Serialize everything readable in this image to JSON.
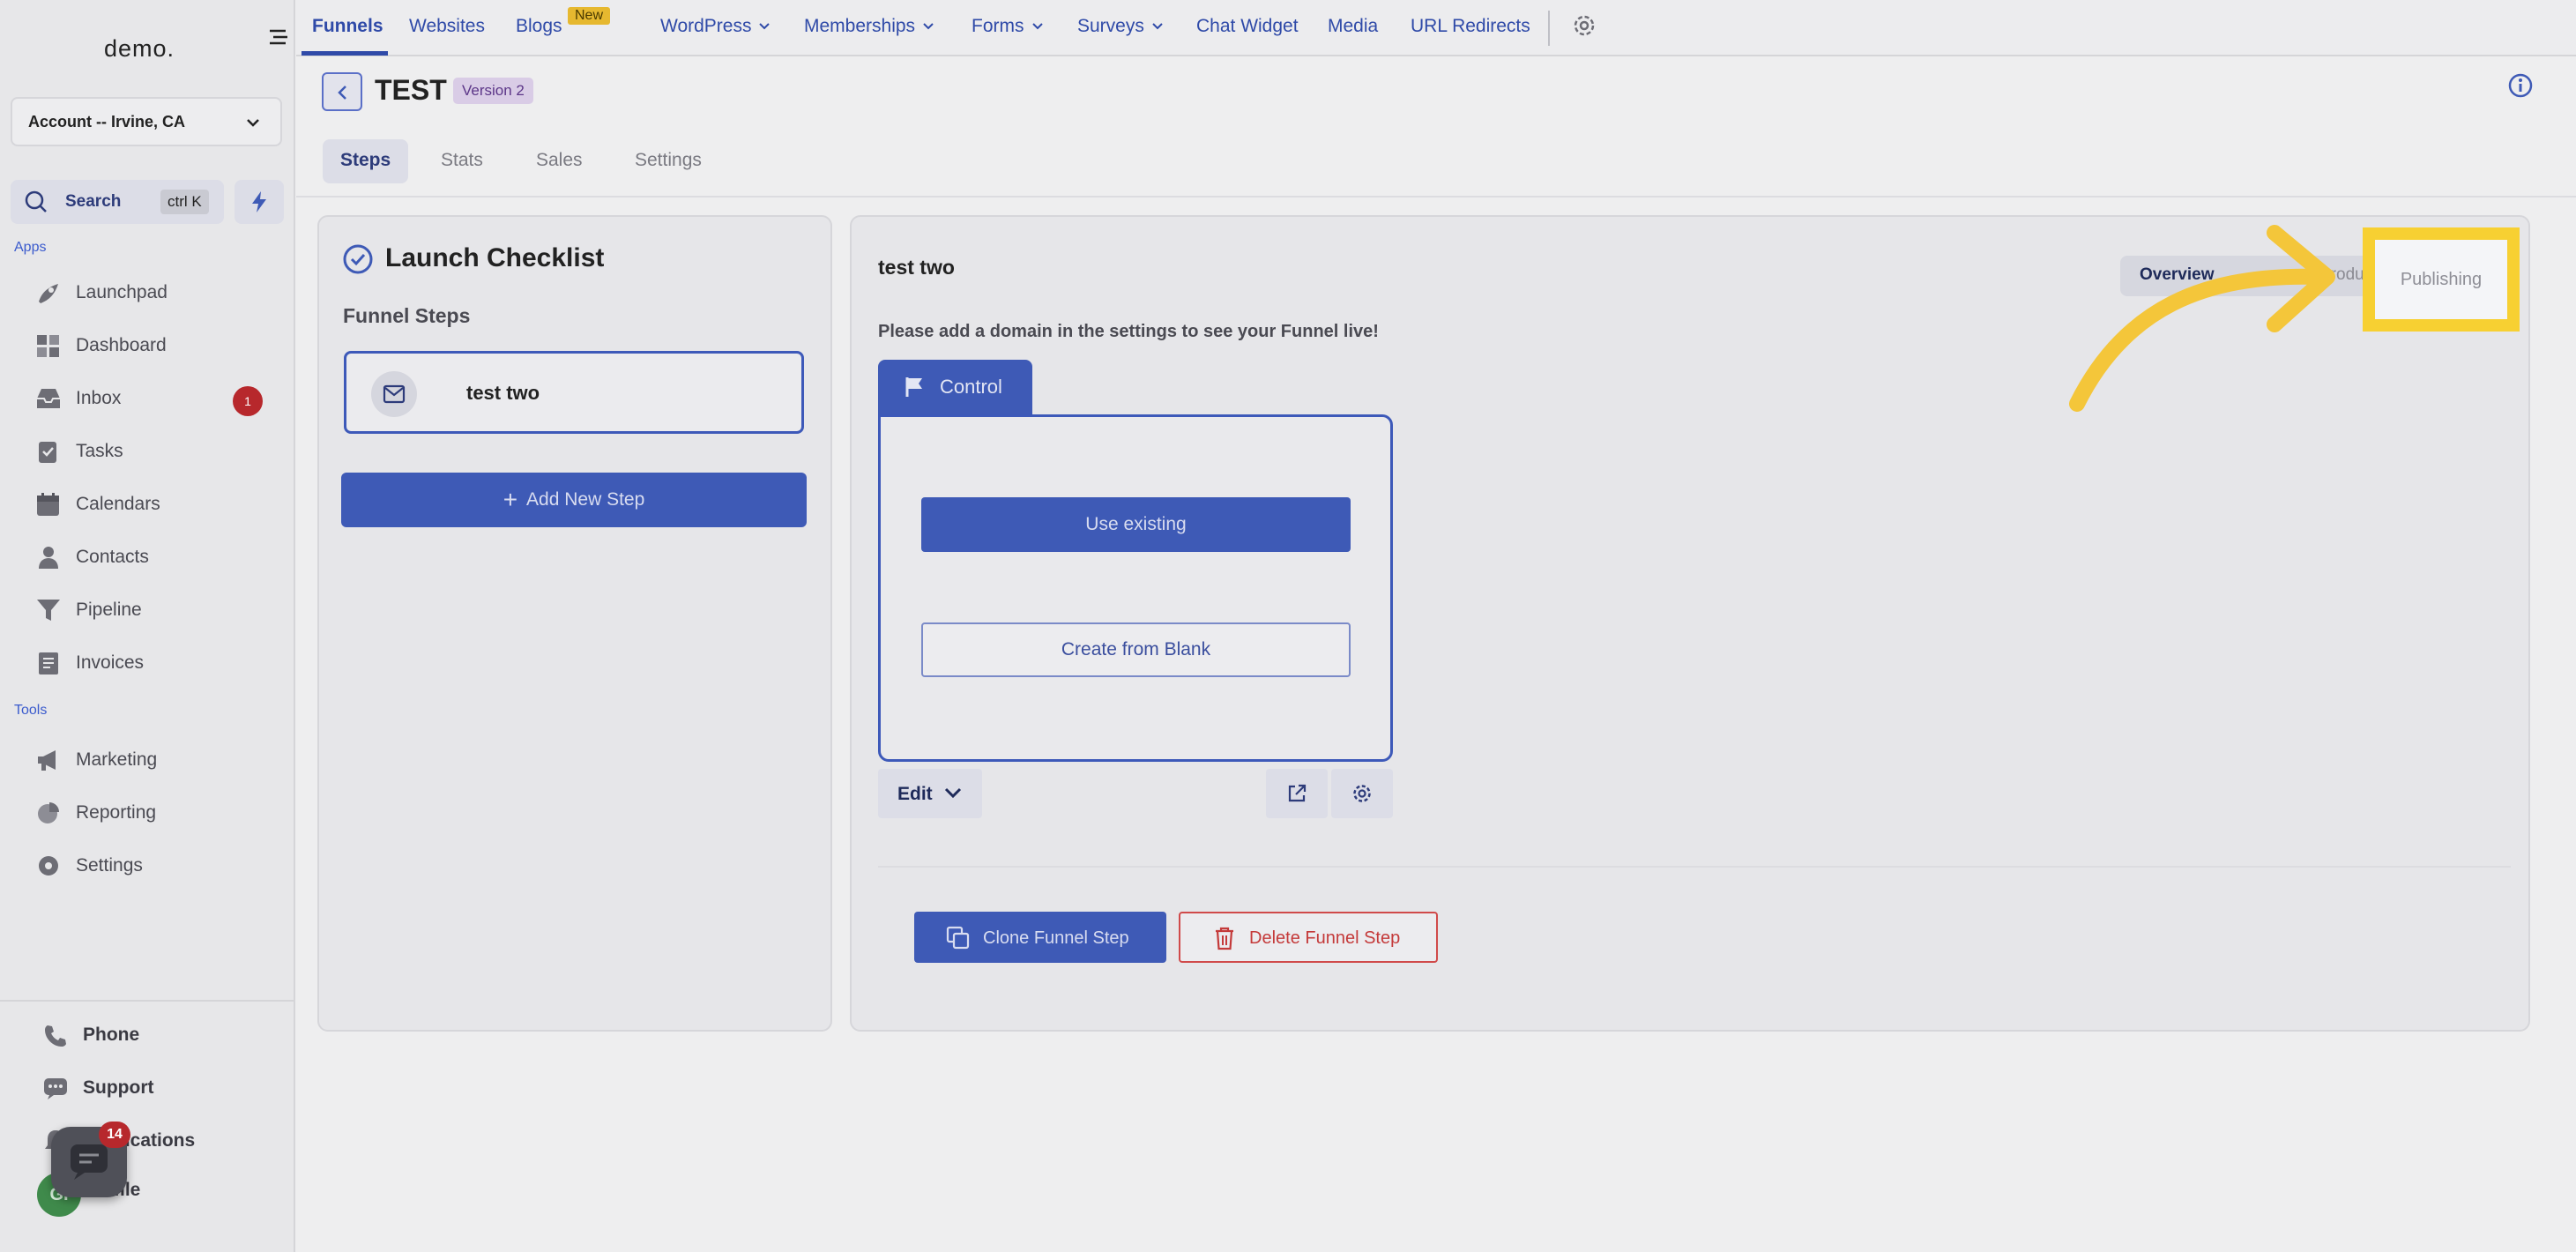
{
  "sidebar": {
    "logo": "demo.",
    "account": "Account -- Irvine, CA",
    "search": {
      "label": "Search",
      "shortcut": "ctrl K"
    },
    "sections": {
      "apps": "Apps",
      "tools": "Tools"
    },
    "apps": [
      {
        "label": "Launchpad",
        "icon": "rocket-icon"
      },
      {
        "label": "Dashboard",
        "icon": "dashboard-icon"
      },
      {
        "label": "Inbox",
        "icon": "inbox-icon",
        "badge": "1"
      },
      {
        "label": "Tasks",
        "icon": "tasks-icon"
      },
      {
        "label": "Calendars",
        "icon": "calendar-icon"
      },
      {
        "label": "Contacts",
        "icon": "contacts-icon"
      },
      {
        "label": "Pipeline",
        "icon": "pipeline-icon"
      },
      {
        "label": "Invoices",
        "icon": "invoices-icon"
      }
    ],
    "tools": [
      {
        "label": "Marketing",
        "icon": "megaphone-icon"
      },
      {
        "label": "Reporting",
        "icon": "pie-chart-icon"
      },
      {
        "label": "Settings",
        "icon": "gear-icon"
      }
    ],
    "bottom": [
      {
        "label": "Phone",
        "icon": "phone-icon"
      },
      {
        "label": "Support",
        "icon": "support-icon"
      },
      {
        "label": "Notifications",
        "icon": "bell-icon"
      },
      {
        "label": "Profile",
        "icon": "avatar"
      }
    ],
    "chat_badge": "14",
    "avatar_initials": "GI"
  },
  "topnav": {
    "items": [
      "Funnels",
      "Websites",
      "Blogs",
      "WordPress",
      "Memberships",
      "Forms",
      "Surveys",
      "Chat Widget",
      "Media",
      "URL Redirects"
    ],
    "new_badge": "New"
  },
  "header": {
    "title": "TEST",
    "version": "Version 2",
    "tabs": [
      "Steps",
      "Stats",
      "Sales",
      "Settings"
    ]
  },
  "checklist": {
    "title": "Launch Checklist",
    "steps_label": "Funnel Steps",
    "step_name": "test two",
    "add_step": "Add New Step"
  },
  "step_detail": {
    "title": "test two",
    "tabs": [
      "Overview",
      "Products",
      "Publishing"
    ],
    "domain_note": "Please add a domain in the settings to see your Funnel live!",
    "variant_tab": "Control",
    "use_existing": "Use existing",
    "create_blank": "Create from Blank",
    "edit": "Edit",
    "clone": "Clone Funnel Step",
    "delete": "Delete Funnel Step"
  },
  "colors": {
    "primary": "#3e5ab6",
    "highlight": "#f7d032",
    "danger": "#c43a3a",
    "badge_red": "#b7282c"
  }
}
